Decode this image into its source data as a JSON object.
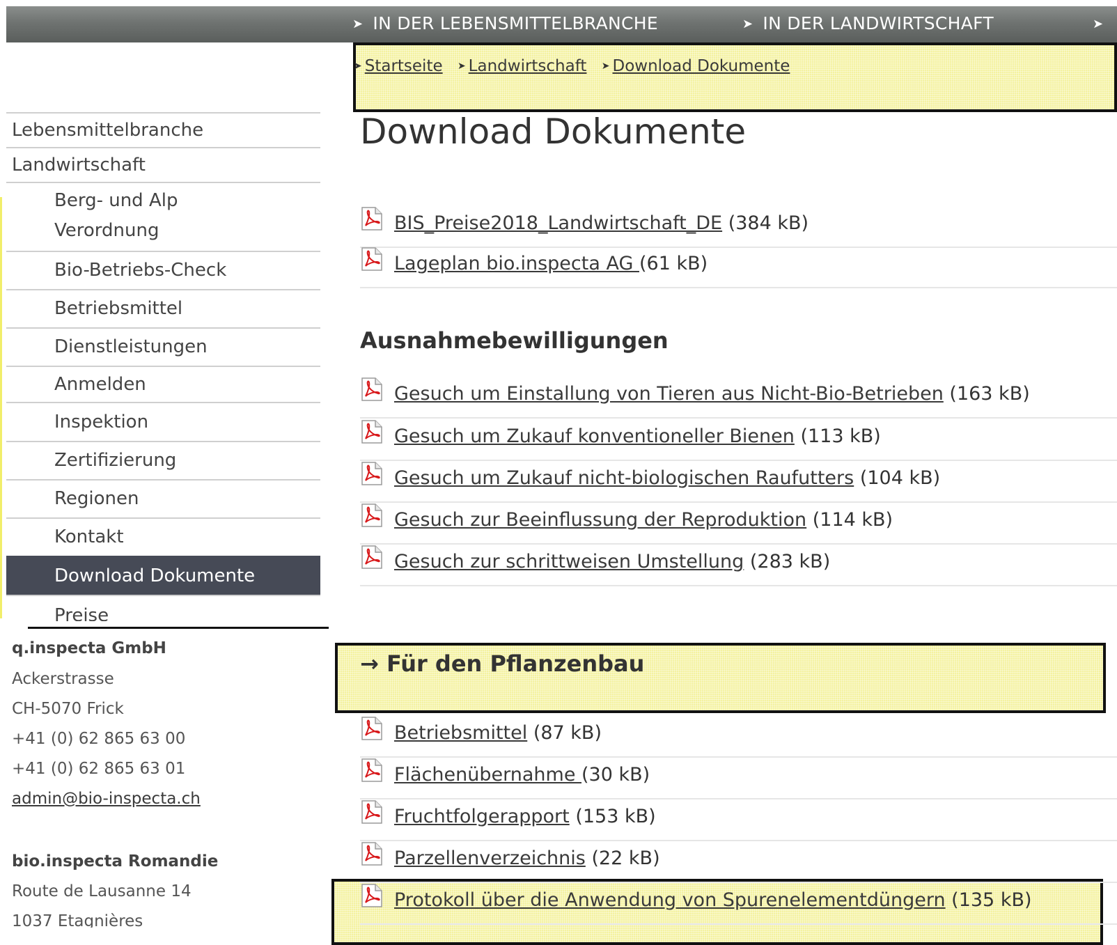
{
  "topnav": {
    "items": [
      "IN DER LEBENSMITTELBRANCHE",
      "IN DER LANDWIRTSCHAFT",
      ""
    ]
  },
  "breadcrumb": {
    "items": [
      "Startseite",
      "Landwirtschaft",
      "Download Dokumente"
    ]
  },
  "page_title": "Download Dokumente",
  "sidebar": {
    "items": [
      {
        "label": "Lebensmittelbranche"
      },
      {
        "label": "Landwirtschaft"
      },
      {
        "label": "Berg- und Alp",
        "label2": "Verordnung"
      },
      {
        "label": "Bio-Betriebs-Check"
      },
      {
        "label": "Betriebsmittel"
      },
      {
        "label": "Dienstleistungen"
      },
      {
        "label": "Anmelden"
      },
      {
        "label": "Inspektion"
      },
      {
        "label": "Zertifizierung"
      },
      {
        "label": "Regionen"
      },
      {
        "label": "Kontakt"
      },
      {
        "label": "Download Dokumente"
      },
      {
        "label": "Preise"
      }
    ]
  },
  "contacts": [
    {
      "name": "q.inspecta GmbH",
      "lines": [
        "Ackerstrasse",
        "CH-5070 Frick",
        "+41 (0) 62 865 63 00",
        "+41 (0) 62 865 63 01"
      ],
      "email": "admin@bio-inspecta.ch"
    },
    {
      "name": "bio.inspecta Romandie",
      "lines": [
        "Route de Lausanne 14",
        "1037 Etagnières"
      ]
    }
  ],
  "documents": {
    "general": [
      {
        "title": "BIS_Preise2018_Landwirtschaft_DE",
        "size": "(384 kB)"
      },
      {
        "title": "Lageplan bio.inspecta AG ",
        "size": "(61 kB)"
      }
    ],
    "ausnahme": {
      "heading": "Ausnahmebewilligungen",
      "items": [
        {
          "title": "Gesuch um Einstallung von Tieren aus Nicht-Bio-Betrieben",
          "size": "(163 kB)"
        },
        {
          "title": "Gesuch um Zukauf konventioneller Bienen",
          "size": "(113 kB)"
        },
        {
          "title": "Gesuch um Zukauf nicht-biologischen Raufutters",
          "size": "(104 kB)"
        },
        {
          "title": "Gesuch zur Beeinflussung der Reproduktion",
          "size": "(114 kB)"
        },
        {
          "title": "Gesuch zur schrittweisen Umstellung",
          "size": "(283 kB)"
        }
      ]
    },
    "pflanzenbau": {
      "heading": "→ Für den Pflanzenbau",
      "items": [
        {
          "title": "Betriebsmittel",
          "size": "(87 kB)"
        },
        {
          "title": "Flächenübernahme ",
          "size": "(30 kB)"
        },
        {
          "title": "Fruchtfolgerapport",
          "size": "(153 kB)"
        },
        {
          "title": "Parzellenverzeichnis",
          "size": "(22 kB)"
        },
        {
          "title": "Protokoll über die Anwendung von Spurenelementdüngern",
          "size": "(135 kB)"
        }
      ]
    }
  },
  "icons": {
    "pdf": "pdf-icon",
    "nav_arrow": "chevron-right-icon"
  },
  "colors": {
    "topbar": "#6f7371",
    "active_nav": "#464a56",
    "highlight": "#f4f2a0"
  }
}
